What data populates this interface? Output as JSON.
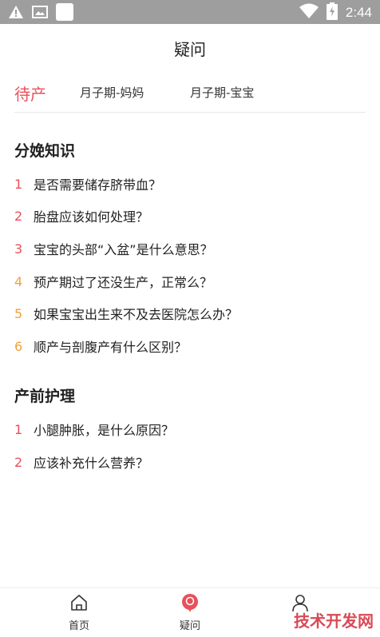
{
  "status_bar": {
    "time": "2:44",
    "icons": [
      "warning-icon",
      "image-icon",
      "notification-square-icon",
      "wifi-icon",
      "battery-charging-icon"
    ]
  },
  "header": {
    "title": "疑问"
  },
  "tabs": [
    {
      "label": "待产",
      "active": true
    },
    {
      "label": "月子期-妈妈",
      "active": false
    },
    {
      "label": "月子期-宝宝",
      "active": false
    }
  ],
  "sections": [
    {
      "title": "分娩知识",
      "items": [
        {
          "num": "1",
          "text": "是否需要储存脐带血？",
          "num_color": "#e8505b"
        },
        {
          "num": "2",
          "text": "胎盘应该如何处理？",
          "num_color": "#e8505b"
        },
        {
          "num": "3",
          "text": "宝宝的头部“入盆”是什么意思？",
          "num_color": "#e8505b"
        },
        {
          "num": "4",
          "text": "预产期过了还没生产，正常么？",
          "num_color": "#f2a23a"
        },
        {
          "num": "5",
          "text": "如果宝宝出生来不及去医院怎么办？",
          "num_color": "#f2a23a"
        },
        {
          "num": "6",
          "text": "顺产与剖腹产有什么区别？",
          "num_color": "#f2a23a"
        }
      ]
    },
    {
      "title": "产前护理",
      "items": [
        {
          "num": "1",
          "text": "小腿肿胀，是什么原因？",
          "num_color": "#e8505b"
        },
        {
          "num": "2",
          "text": "应该补充什么营养？",
          "num_color": "#e8505b"
        }
      ]
    }
  ],
  "bottom_nav": [
    {
      "label": "首页",
      "icon": "home-icon"
    },
    {
      "label": "疑问",
      "icon": "question-bubble-icon"
    },
    {
      "label": "",
      "icon": "user-icon"
    }
  ],
  "watermark": "技术开发网",
  "colors": {
    "accent": "#e8505b",
    "orange": "#f2a23a",
    "status_bar": "#9e9e9e"
  }
}
